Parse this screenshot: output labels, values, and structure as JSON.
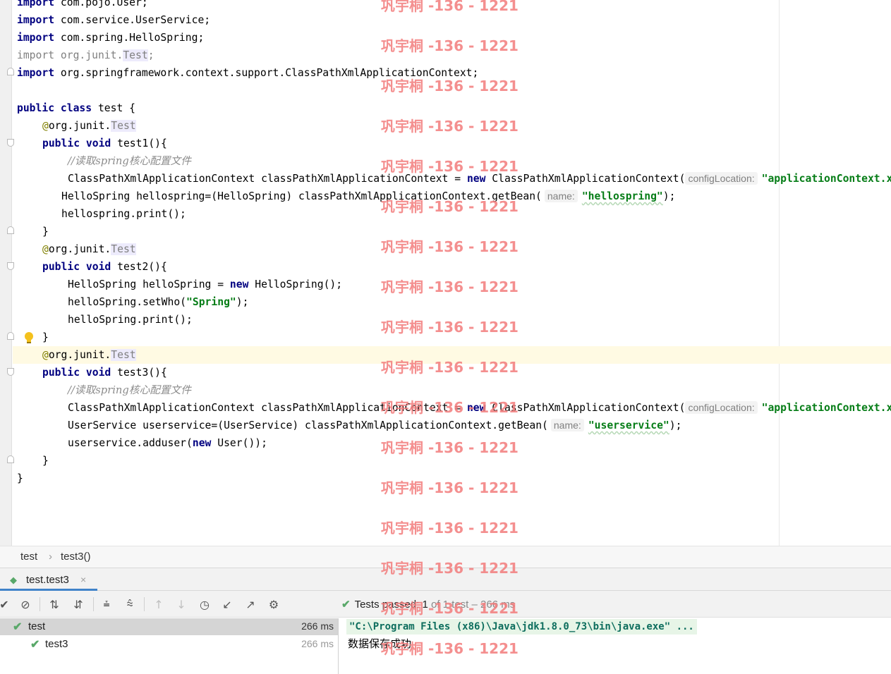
{
  "editor": {
    "lines": {
      "l1_kw": "import",
      "l1_rest": " com.pojo.User;",
      "l2_kw": "import",
      "l2_rest": " com.service.UserService;",
      "l3_kw": "import",
      "l3_rest": " com.spring.HelloSpring;",
      "l4_kw": "import",
      "l4_pkg": " org.junit.",
      "l4_test": "Test",
      "l4_semi": ";",
      "l5_kw": "import",
      "l5_rest": " org.springframework.context.support.ClassPathXmlApplicationContext;",
      "l7_kw1": "public",
      "l7_kw2": "class",
      "l7_rest": " test {",
      "ann_at": "@",
      "ann_pkg": "org.junit.",
      "ann_test": "Test",
      "l9_kw1": "public",
      "l9_kw2": "void",
      "l9_rest": " test1(){",
      "comment": "//读取spring核心配置文件",
      "ctx_decl": "ClassPathXmlApplicationContext classPathXmlApplicationContext = ",
      "kw_new": "new",
      "ctx_ctor": " ClassPathXmlApplicationContext(",
      "hint_config": "configLocation:",
      "str_app": "\"applicationContext.xml\");",
      "l12_pre": "HelloSpring hellospring=(HelloSpring) classPathXmlApplicationContext.getBean(",
      "hint_name": "name:",
      "str_hellospring": "\"hellospring\"",
      "close_paren": ");",
      "l13": "hellospring.print();",
      "brace_close": "}",
      "l15_kw1": "public",
      "l15_kw2": "void",
      "l15_rest": " test2(){",
      "l16_pre": "HelloSpring helloSpring = ",
      "l16_post": " HelloSpring();",
      "l17_pre": "helloSpring.setWho(",
      "str_spring": "\"Spring\"",
      "l18": "helloSpring.print();",
      "l21_kw1": "public",
      "l21_kw2": "void",
      "l21_rest": " test3(){",
      "l24_pre": "UserService userservice=(UserService) classPathXmlApplicationContext.getBean(",
      "str_userservice": "\"userservice\"",
      "l25_pre": "userservice.adduser(",
      "l25_post": " User());"
    }
  },
  "watermark": "巩宇桐 -136 - 1221",
  "breadcrumb": {
    "item1": "test",
    "sep": "›",
    "item2": "test3()"
  },
  "run_tab": {
    "label": "test.test3",
    "close": "×"
  },
  "toolbar_status": {
    "passed": "Tests passed:",
    "count": "1",
    "rest": "of 1 test – 266 ms"
  },
  "test_tree": [
    {
      "name": "test",
      "time": "266 ms"
    },
    {
      "name": "test3",
      "time": "266 ms"
    }
  ],
  "console": {
    "command": "\"C:\\Program Files (x86)\\Java\\jdk1.8.0_73\\bin\\java.exe\" ...",
    "output": "数据保存成功"
  },
  "colors": {
    "keyword": "#000080",
    "string": "#067d17",
    "annotation": "#808000",
    "watermark": "#f37c7c",
    "pass": "#59a869"
  }
}
